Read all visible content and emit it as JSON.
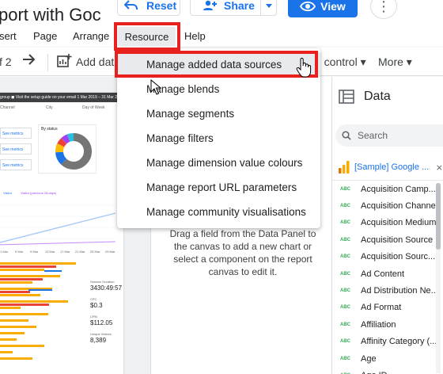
{
  "app": {
    "doc_title": "port with Goc"
  },
  "header": {
    "reset_label": "Reset",
    "share_label": "Share",
    "view_label": "View",
    "more_glyph": "⋮"
  },
  "menubar": {
    "items": [
      "sert",
      "Page",
      "Arrange",
      "Resource",
      "Help"
    ]
  },
  "toolbar": {
    "page_indicator": "f 2",
    "add_data_label": "Add dat",
    "control_label": "u control",
    "more_label": "More"
  },
  "resource_menu": {
    "items": [
      "Manage added data sources",
      "Manage blends",
      "Manage segments",
      "Manage filters",
      "Manage dimension value colours",
      "Manage report URL parameters",
      "Manage community visualisations"
    ],
    "active_index": 0
  },
  "canvas": {
    "drag_hint": "Drag a field from the Data Panel to the canvas to add a new chart or select a component on the report canvas to edit it."
  },
  "report_thumbnail": {
    "header_text": "group  ◼ Visit the setup guide on your email  1 Mar 2019 – 31 Mar 2019",
    "filters": [
      "Channel",
      "City",
      "Day of Week"
    ],
    "card_label": "See metrics",
    "donut_title": "By status",
    "donut_slices": [
      {
        "value": 62,
        "color": "#757575"
      },
      {
        "value": 12,
        "color": "#1a73e8"
      },
      {
        "value": 8,
        "color": "#fbbc04"
      },
      {
        "value": 6,
        "color": "#ea4335"
      },
      {
        "value": 6,
        "color": "#a142f4"
      },
      {
        "value": 6,
        "color": "#24c1e0"
      }
    ],
    "legend": [
      "Visitor",
      "Visitor (previous 28 days)"
    ],
    "x_ticks": [
      "1 Mar",
      "5 Mar",
      "9 Mar",
      "13 Mar",
      "17 Mar",
      "21 Mar",
      "25 Mar",
      "29 Mar"
    ],
    "stats": [
      {
        "label": "Session Duration",
        "value": "3430:49:57"
      },
      {
        "label": "CPC",
        "value": "$0.3"
      },
      {
        "label": "CPM",
        "value": "$112.05"
      },
      {
        "label": "Unique Visitors",
        "value": "8,389"
      }
    ]
  },
  "data_panel": {
    "title": "Data",
    "search_placeholder": "Search",
    "source_name": "[Sample] Google ...",
    "field_type_label": "ABC",
    "fields": [
      "Acquisition Camp...",
      "Acquisition Channel",
      "Acquisition Medium",
      "Acquisition Source",
      "Acquisition Sourc...",
      "Ad Content",
      "Ad Distribution Ne...",
      "Ad Format",
      "Affiliation",
      "Affinity Category (...",
      "Age",
      "Age ID"
    ]
  },
  "colors": {
    "accent": "#1a73e8",
    "highlight": "#e8201e",
    "field_type": "#34a853",
    "source_icon_orange": "#f9ab00"
  }
}
